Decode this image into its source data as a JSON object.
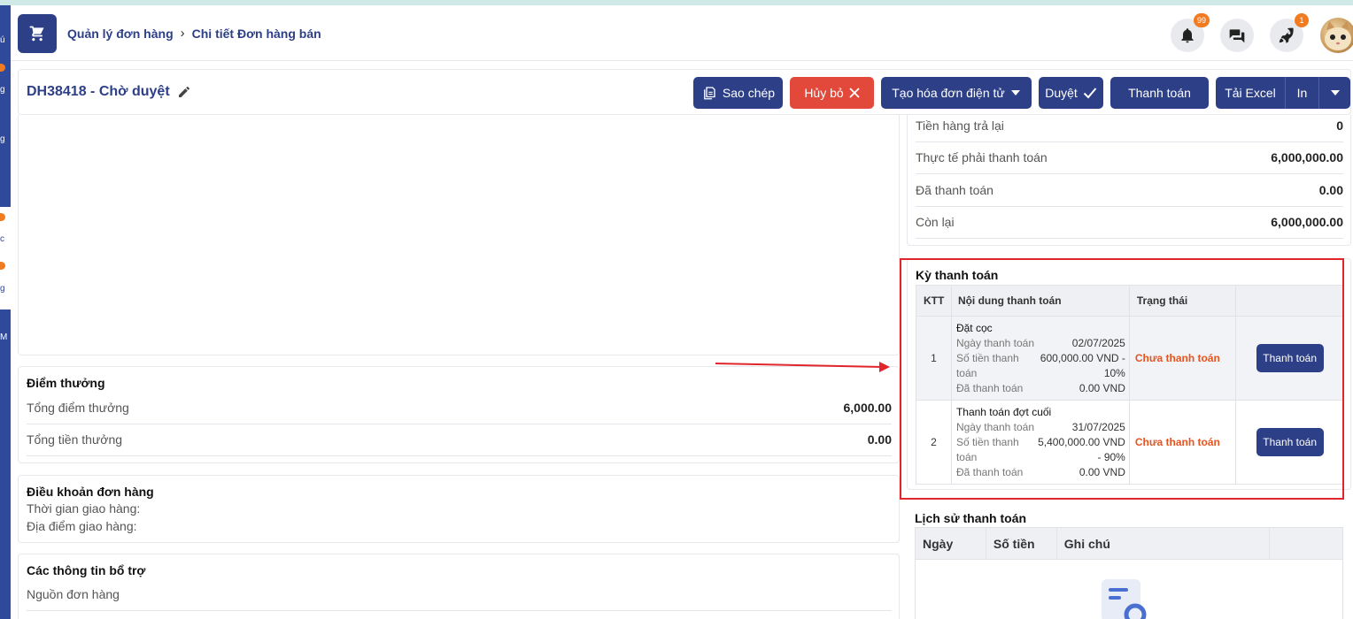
{
  "sidebar": {
    "letters": [
      "ú",
      "g",
      "g",
      "c",
      "g",
      "M"
    ]
  },
  "header": {
    "breadcrumb": [
      "Quản lý đơn hàng",
      "Chi tiết Đơn hàng bán"
    ],
    "notification_count": "99",
    "rocket_count": "1",
    "icons": [
      "cart-icon",
      "bell-icon",
      "chat-icon",
      "rocket-icon"
    ]
  },
  "order": {
    "title": "DH38418 - Chờ duyệt"
  },
  "toolbar": {
    "copy": "Sao chép",
    "cancel": "Hủy bỏ",
    "einvoice": "Tạo hóa đơn điện tử",
    "approve": "Duyệt",
    "pay": "Thanh toán",
    "excel": "Tải Excel",
    "print": "In"
  },
  "summary": {
    "rows": [
      {
        "label": "Tiền hàng trả lại",
        "value": "0"
      },
      {
        "label": "Thực tế phải thanh toán",
        "value": "6,000,000.00"
      },
      {
        "label": "Đã thanh toán",
        "value": "0.00"
      },
      {
        "label": "Còn lại",
        "value": "6,000,000.00"
      }
    ]
  },
  "points": {
    "title": "Điểm thưởng",
    "rows": [
      {
        "label": "Tổng điểm thưởng",
        "value": "6,000.00"
      },
      {
        "label": "Tổng tiền thưởng",
        "value": "0.00"
      }
    ]
  },
  "terms": {
    "title": "Điều khoản đơn hàng",
    "delivery_time": "Thời gian giao hàng:",
    "delivery_place": "Địa điểm giao hàng:"
  },
  "extra": {
    "title": "Các thông tin bổ trợ",
    "source": "Nguồn đơn hàng"
  },
  "payment_terms": {
    "title": "Kỳ thanh toán",
    "headers": [
      "KTT",
      "Nội dung thanh toán",
      "Trạng thái",
      ""
    ],
    "labels": {
      "date": "Ngày thanh toán",
      "amount": "Số tiền thanh toán",
      "paid": "Đã thanh toán"
    },
    "rows": [
      {
        "no": "1",
        "name": "Đặt cọc",
        "date": "02/07/2025",
        "amount": "600,000.00 VND - 10%",
        "paid": "0.00 VND",
        "status": "Chưa thanh toán",
        "action": "Thanh toán"
      },
      {
        "no": "2",
        "name": "Thanh toán đợt cuối",
        "date": "31/07/2025",
        "amount": "5,400,000.00 VND - 90%",
        "paid": "0.00 VND",
        "status": "Chưa thanh toán",
        "action": "Thanh toán"
      }
    ]
  },
  "payment_history": {
    "title": "Lịch sử thanh toán",
    "headers": [
      "Ngày",
      "Số tiền",
      "Ghi chú",
      ""
    ]
  },
  "colors": {
    "primary": "#2c3f87",
    "danger": "#e2493a",
    "status": "#e8531f",
    "annotation": "#e0262b"
  }
}
